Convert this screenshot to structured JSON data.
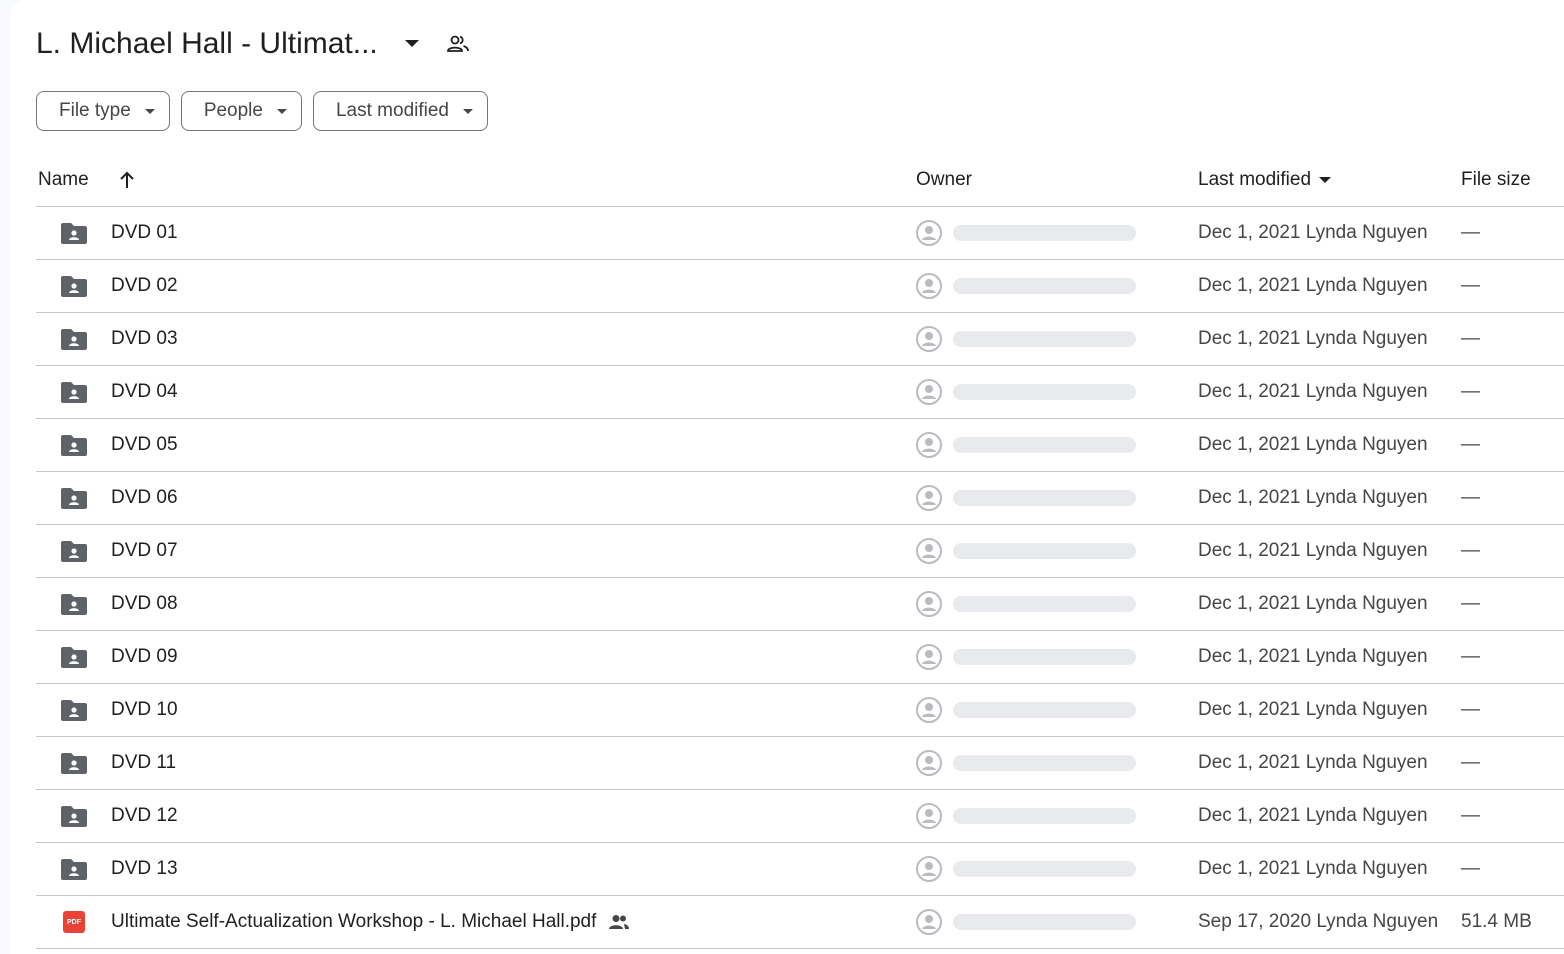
{
  "header": {
    "title": "L. Michael Hall - Ultimat...",
    "caret_icon": "arrow-drop-down-icon",
    "shared_icon": "people-outline-icon"
  },
  "filters": [
    {
      "label": "File type"
    },
    {
      "label": "People"
    },
    {
      "label": "Last modified"
    }
  ],
  "table": {
    "columns": {
      "name": "Name",
      "owner": "Owner",
      "last_modified": "Last modified",
      "file_size": "File size"
    },
    "sort": {
      "column": "name",
      "direction": "ascending",
      "icon": "arrow-upward-icon"
    },
    "rows": [
      {
        "type": "shared-folder",
        "name": "DVD 01",
        "modified": "Dec 1, 2021 Lynda Nguyen",
        "size": "—"
      },
      {
        "type": "shared-folder",
        "name": "DVD 02",
        "modified": "Dec 1, 2021 Lynda Nguyen",
        "size": "—"
      },
      {
        "type": "shared-folder",
        "name": "DVD 03",
        "modified": "Dec 1, 2021 Lynda Nguyen",
        "size": "—"
      },
      {
        "type": "shared-folder",
        "name": "DVD 04",
        "modified": "Dec 1, 2021 Lynda Nguyen",
        "size": "—"
      },
      {
        "type": "shared-folder",
        "name": "DVD 05",
        "modified": "Dec 1, 2021 Lynda Nguyen",
        "size": "—"
      },
      {
        "type": "shared-folder",
        "name": "DVD 06",
        "modified": "Dec 1, 2021 Lynda Nguyen",
        "size": "—"
      },
      {
        "type": "shared-folder",
        "name": "DVD 07",
        "modified": "Dec 1, 2021 Lynda Nguyen",
        "size": "—"
      },
      {
        "type": "shared-folder",
        "name": "DVD 08",
        "modified": "Dec 1, 2021 Lynda Nguyen",
        "size": "—"
      },
      {
        "type": "shared-folder",
        "name": "DVD 09",
        "modified": "Dec 1, 2021 Lynda Nguyen",
        "size": "—"
      },
      {
        "type": "shared-folder",
        "name": "DVD 10",
        "modified": "Dec 1, 2021 Lynda Nguyen",
        "size": "—"
      },
      {
        "type": "shared-folder",
        "name": "DVD 11",
        "modified": "Dec 1, 2021 Lynda Nguyen",
        "size": "—"
      },
      {
        "type": "shared-folder",
        "name": "DVD 12",
        "modified": "Dec 1, 2021 Lynda Nguyen",
        "size": "—"
      },
      {
        "type": "shared-folder",
        "name": "DVD 13",
        "modified": "Dec 1, 2021 Lynda Nguyen",
        "size": "—"
      },
      {
        "type": "pdf",
        "name": "Ultimate Self-Actualization Workshop - L. Michael Hall.pdf",
        "shared": true,
        "badge": "PDF",
        "modified": "Sep 17, 2020 Lynda Nguyen",
        "size": "51.4 MB"
      }
    ]
  },
  "colors": {
    "text_primary": "#1f1f1f",
    "text_secondary": "#444746",
    "divider": "#c4c7c5",
    "folder_icon": "#5f6368",
    "pdf_icon": "#ea4335",
    "owner_placeholder": "#e8eaed"
  }
}
